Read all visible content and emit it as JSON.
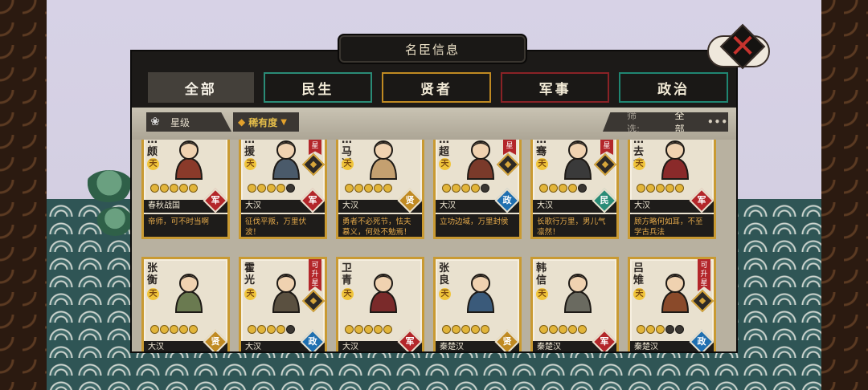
{
  "window": {
    "title": "名臣信息"
  },
  "close_icon": "close-x-icon",
  "tabs": [
    {
      "label": "全部",
      "active": true
    },
    {
      "label": "民生",
      "active": false
    },
    {
      "label": "贤者",
      "active": false
    },
    {
      "label": "军事",
      "active": false
    },
    {
      "label": "政治",
      "active": false
    }
  ],
  "filters": {
    "star_sort_label": "星级",
    "rarity_sort_label": "稀有度",
    "filter_label": "筛选:",
    "filter_value": "全部",
    "more_label": "•••"
  },
  "colors": {
    "civil": "#2a8c77",
    "sage": "#c08a22",
    "military": "#b3262a",
    "politics": "#1f6fb0"
  },
  "cards": [
    {
      "name": "…颇",
      "grade": "天",
      "stars": 5,
      "max_stars": 5,
      "dynasty": "春秋战国",
      "role": "军",
      "role_type": "military",
      "quote": "帝师，可不时当啊",
      "upgrade": ""
    },
    {
      "name": "…援",
      "grade": "天",
      "stars": 4,
      "max_stars": 5,
      "dynasty": "大汉",
      "role": "军",
      "role_type": "military",
      "quote": "征伐平叛，万里伏波！",
      "upgrade": "升星"
    },
    {
      "name": "…马迁",
      "grade": "天",
      "stars": 5,
      "max_stars": 5,
      "dynasty": "大汉",
      "role": "贤",
      "role_type": "sage",
      "quote": "勇者不必死节，怯夫慕义，何处不勉焉！",
      "upgrade": ""
    },
    {
      "name": "…超",
      "grade": "天",
      "stars": 4,
      "max_stars": 5,
      "dynasty": "大汉",
      "role": "政",
      "role_type": "politics",
      "quote": "立功边域，万里封侯",
      "upgrade": "升星"
    },
    {
      "name": "…骞",
      "grade": "天",
      "stars": 4,
      "max_stars": 5,
      "dynasty": "大汉",
      "role": "民",
      "role_type": "civil",
      "quote": "长歌行万里，男儿气凛然！",
      "upgrade": "升星"
    },
    {
      "name": "…去病",
      "grade": "天",
      "stars": 5,
      "max_stars": 5,
      "dynasty": "大汉",
      "role": "军",
      "role_type": "military",
      "quote": "顾方略何如耳，不至学古兵法",
      "upgrade": ""
    },
    {
      "name": "张衡",
      "grade": "天",
      "stars": 5,
      "max_stars": 5,
      "dynasty": "大汉",
      "role": "贤",
      "role_type": "sage",
      "quote": "",
      "upgrade": ""
    },
    {
      "name": "霍光",
      "grade": "天",
      "stars": 4,
      "max_stars": 5,
      "dynasty": "大汉",
      "role": "政",
      "role_type": "politics",
      "quote": "",
      "upgrade": "可升星"
    },
    {
      "name": "卫青",
      "grade": "天",
      "stars": 5,
      "max_stars": 5,
      "dynasty": "大汉",
      "role": "军",
      "role_type": "military",
      "quote": "",
      "upgrade": ""
    },
    {
      "name": "张良",
      "grade": "天",
      "stars": 5,
      "max_stars": 5,
      "dynasty": "秦楚汉",
      "role": "贤",
      "role_type": "sage",
      "quote": "",
      "upgrade": ""
    },
    {
      "name": "韩信",
      "grade": "天",
      "stars": 5,
      "max_stars": 5,
      "dynasty": "秦楚汉",
      "role": "军",
      "role_type": "military",
      "quote": "",
      "upgrade": ""
    },
    {
      "name": "吕雉",
      "grade": "天",
      "stars": 3,
      "max_stars": 5,
      "dynasty": "秦楚汉",
      "role": "政",
      "role_type": "politics",
      "quote": "",
      "upgrade": "可升星"
    }
  ]
}
